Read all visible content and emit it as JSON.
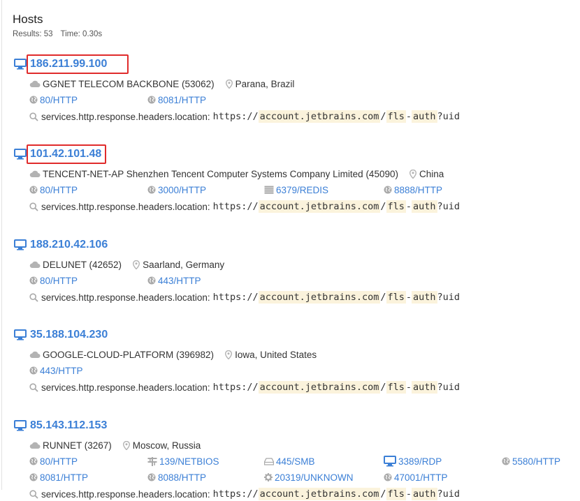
{
  "header": {
    "title": "Hosts",
    "results": "Results: 53",
    "time": "Time: 0.30s"
  },
  "hosts": [
    {
      "ip": "186.211.99.100",
      "asn": "GGNET TELECOM BACKBONE (53062)",
      "location": "Parana, Brazil",
      "services": [
        {
          "label": "80/HTTP",
          "icon": "globe-icon"
        },
        {
          "label": "8081/HTTP",
          "icon": "globe-icon"
        }
      ]
    },
    {
      "ip": "101.42.101.48",
      "asn": "TENCENT-NET-AP Shenzhen Tencent Computer Systems Company Limited (45090)",
      "location": "China",
      "services": [
        {
          "label": "80/HTTP",
          "icon": "globe-icon"
        },
        {
          "label": "3000/HTTP",
          "icon": "globe-icon"
        },
        {
          "label": "6379/REDIS",
          "icon": "database-icon"
        },
        {
          "label": "8888/HTTP",
          "icon": "globe-icon"
        }
      ]
    },
    {
      "ip": "188.210.42.106",
      "asn": "DELUNET (42652)",
      "location": "Saarland, Germany",
      "services": [
        {
          "label": "80/HTTP",
          "icon": "globe-icon"
        },
        {
          "label": "443/HTTP",
          "icon": "globe-icon"
        }
      ]
    },
    {
      "ip": "35.188.104.230",
      "asn": "GOOGLE-CLOUD-PLATFORM (396982)",
      "location": "Iowa, United States",
      "services": [
        {
          "label": "443/HTTP",
          "icon": "globe-icon"
        }
      ]
    },
    {
      "ip": "85.143.112.153",
      "asn": "RUNNET (3267)",
      "location": "Moscow, Russia",
      "services": [
        {
          "label": "80/HTTP",
          "icon": "globe-icon"
        },
        {
          "label": "139/NETBIOS",
          "icon": "network-icon"
        },
        {
          "label": "445/SMB",
          "icon": "drive-icon"
        },
        {
          "label": "3389/RDP",
          "icon": "monitor-icon"
        },
        {
          "label": "5580/HTTP",
          "icon": "globe-icon"
        },
        {
          "label": "8081/HTTP",
          "icon": "globe-icon"
        },
        {
          "label": "8088/HTTP",
          "icon": "globe-icon"
        },
        {
          "label": "20319/UNKNOWN",
          "icon": "gear-icon"
        },
        {
          "label": "47001/HTTP",
          "icon": "globe-icon"
        }
      ]
    }
  ],
  "match": {
    "field": "services.http.response.headers.location:",
    "scheme": "https://",
    "domain": "account.jetbrains.com",
    "slash": "/",
    "seg1": "fls",
    "dash": "-",
    "seg2": "auth",
    "query": "?uid"
  }
}
